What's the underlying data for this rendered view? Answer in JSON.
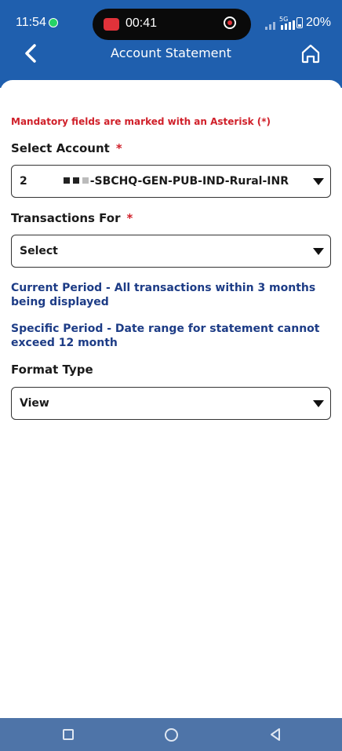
{
  "status_bar": {
    "time": "11:54",
    "recording_time": "00:41",
    "network_label": "5G",
    "battery_percent": "20%"
  },
  "header": {
    "title": "Account Statement"
  },
  "form": {
    "mandatory_note": "Mandatory fields are marked with an Asterisk (*)",
    "select_account_label": "Select Account",
    "asterisk": "*",
    "account_prefix": "2",
    "account_suffix": "-SBCHQ-GEN-PUB-IND-Rural-INR",
    "transactions_label": "Transactions For",
    "transactions_value": "Select",
    "info_current_period": "Current Period - All transactions within 3 months being displayed",
    "info_specific_period": "Specific Period - Date range for statement cannot exceed 12 month",
    "format_type_label": "Format Type",
    "format_type_value": "View"
  },
  "colors": {
    "header_blue": "#1f5fae",
    "required_red": "#d0202a",
    "info_blue": "#1d3c86",
    "nav_bar": "#4e74a8"
  }
}
